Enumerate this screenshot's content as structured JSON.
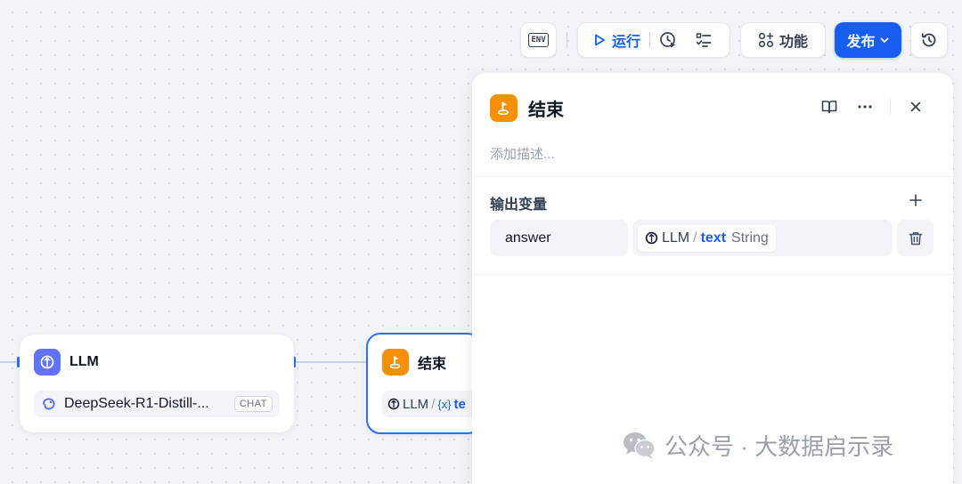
{
  "toolbar": {
    "env_label": "ENV",
    "run_label": "运行",
    "features_label": "功能",
    "publish_label": "发布"
  },
  "canvas": {
    "llm_node": {
      "title": "LLM",
      "model_name": "DeepSeek-R1-Distill-...",
      "model_mode": "CHAT"
    },
    "end_node": {
      "title": "结束",
      "var_source": "LLM",
      "var_slash": "/",
      "var_name_prefix": "{x}",
      "var_name": "te"
    }
  },
  "panel": {
    "title": "结束",
    "description_placeholder": "添加描述...",
    "output_section_title": "输出变量",
    "outputs": [
      {
        "name": "answer",
        "source_node": "LLM",
        "slash": "/",
        "variable": "text",
        "type": "String"
      }
    ]
  },
  "watermark": {
    "text": "公众号 · 大数据启示录"
  },
  "colors": {
    "primary": "#155eef",
    "end_node_accent": "#f79009",
    "llm_node_accent": "#6172f3"
  }
}
